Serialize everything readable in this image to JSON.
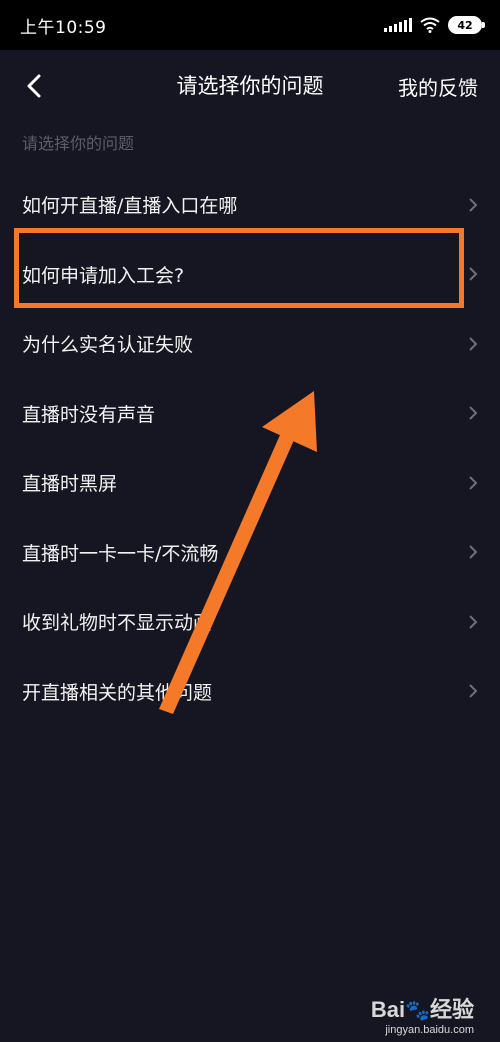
{
  "status_bar": {
    "time": "上午10:59",
    "battery": "42",
    "icons": [
      "signal-icon",
      "wifi-icon",
      "battery-icon"
    ]
  },
  "header": {
    "back_icon": "chevron-left-icon",
    "title": "请选择你的问题",
    "feedback_label": "我的反馈"
  },
  "section_label": "请选择你的问题",
  "questions": [
    {
      "label": "如何开直播/直播入口在哪"
    },
    {
      "label": "如何申请加入工会?"
    },
    {
      "label": "为什么实名认证失败"
    },
    {
      "label": "直播时没有声音"
    },
    {
      "label": "直播时黑屏"
    },
    {
      "label": "直播时一卡一卡/不流畅"
    },
    {
      "label": "收到礼物时不显示动画"
    },
    {
      "label": "开直播相关的其他问题"
    }
  ],
  "overlay": {
    "highlight_color": "#f47a2a",
    "arrow_color": "#f47a2a"
  },
  "watermark": {
    "logo": "Bai",
    "logo_suffix": "经验",
    "url": "jingyan.baidu.com"
  },
  "colors": {
    "background": "#161622",
    "status_bar": "#000000",
    "text": "#f2f2f2",
    "muted": "#5c5c6b"
  }
}
